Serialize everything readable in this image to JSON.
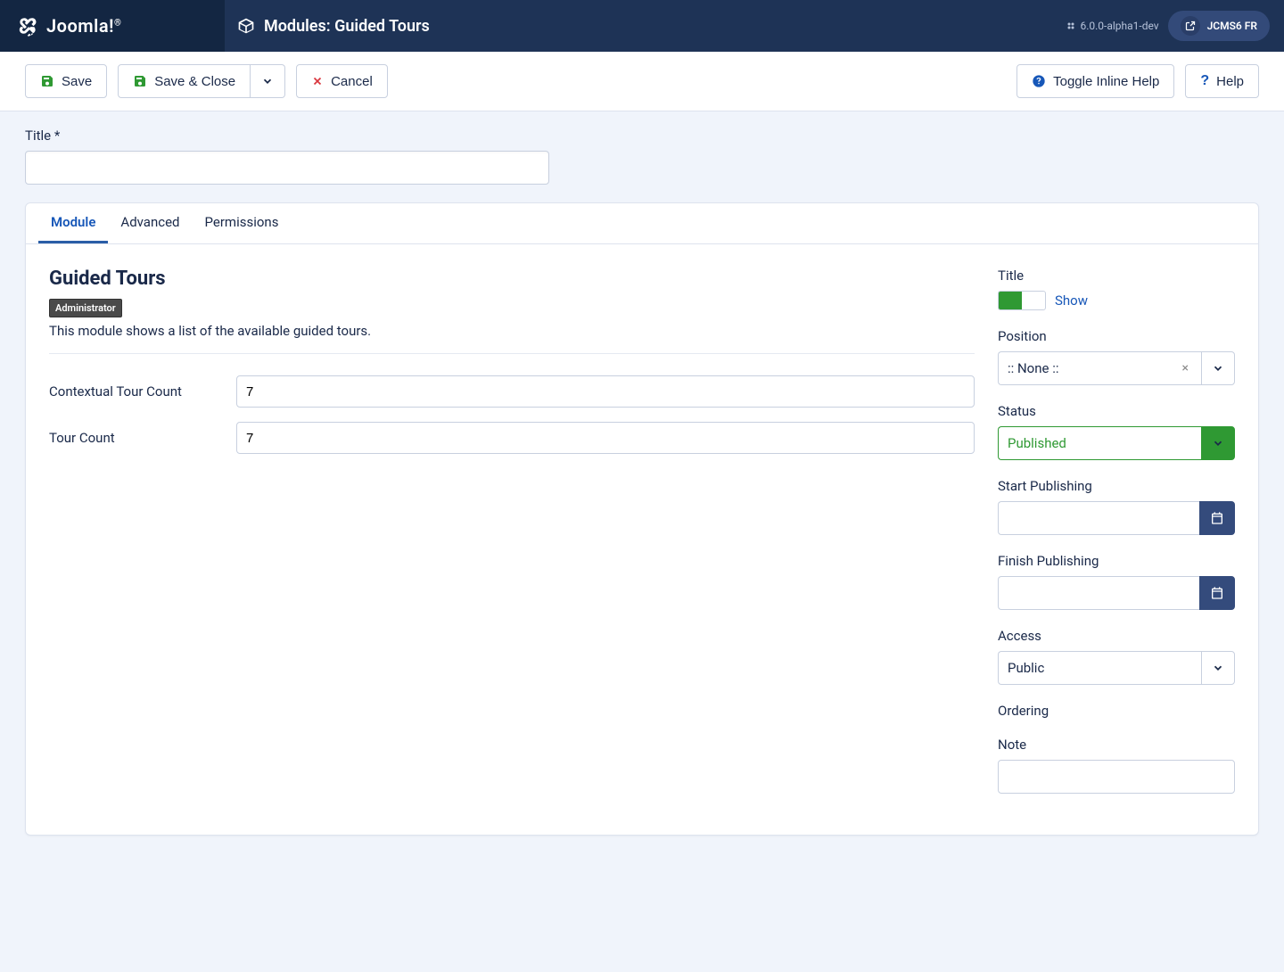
{
  "brand": "Joomla!",
  "header": {
    "title": "Modules: Guided Tours"
  },
  "topbar": {
    "version": "6.0.0-alpha1-dev",
    "user": "JCMS6 FR"
  },
  "toolbar": {
    "save": "Save",
    "save_close": "Save & Close",
    "cancel": "Cancel",
    "toggle_help": "Toggle Inline Help",
    "help": "Help"
  },
  "title_field": {
    "label": "Title",
    "value": ""
  },
  "tabs": [
    "Module",
    "Advanced",
    "Permissions"
  ],
  "module": {
    "name": "Guided Tours",
    "badge": "Administrator",
    "description": "This module shows a list of the available guided tours.",
    "fields": {
      "contextual_count": {
        "label": "Contextual Tour Count",
        "value": "7"
      },
      "tour_count": {
        "label": "Tour Count",
        "value": "7"
      }
    }
  },
  "sidebar": {
    "title": {
      "label": "Title",
      "value": "Show"
    },
    "position": {
      "label": "Position",
      "value": ":: None ::"
    },
    "status": {
      "label": "Status",
      "value": "Published"
    },
    "start_pub": {
      "label": "Start Publishing",
      "value": ""
    },
    "finish_pub": {
      "label": "Finish Publishing",
      "value": ""
    },
    "access": {
      "label": "Access",
      "value": "Public"
    },
    "ordering": {
      "label": "Ordering"
    },
    "note": {
      "label": "Note",
      "value": ""
    }
  }
}
